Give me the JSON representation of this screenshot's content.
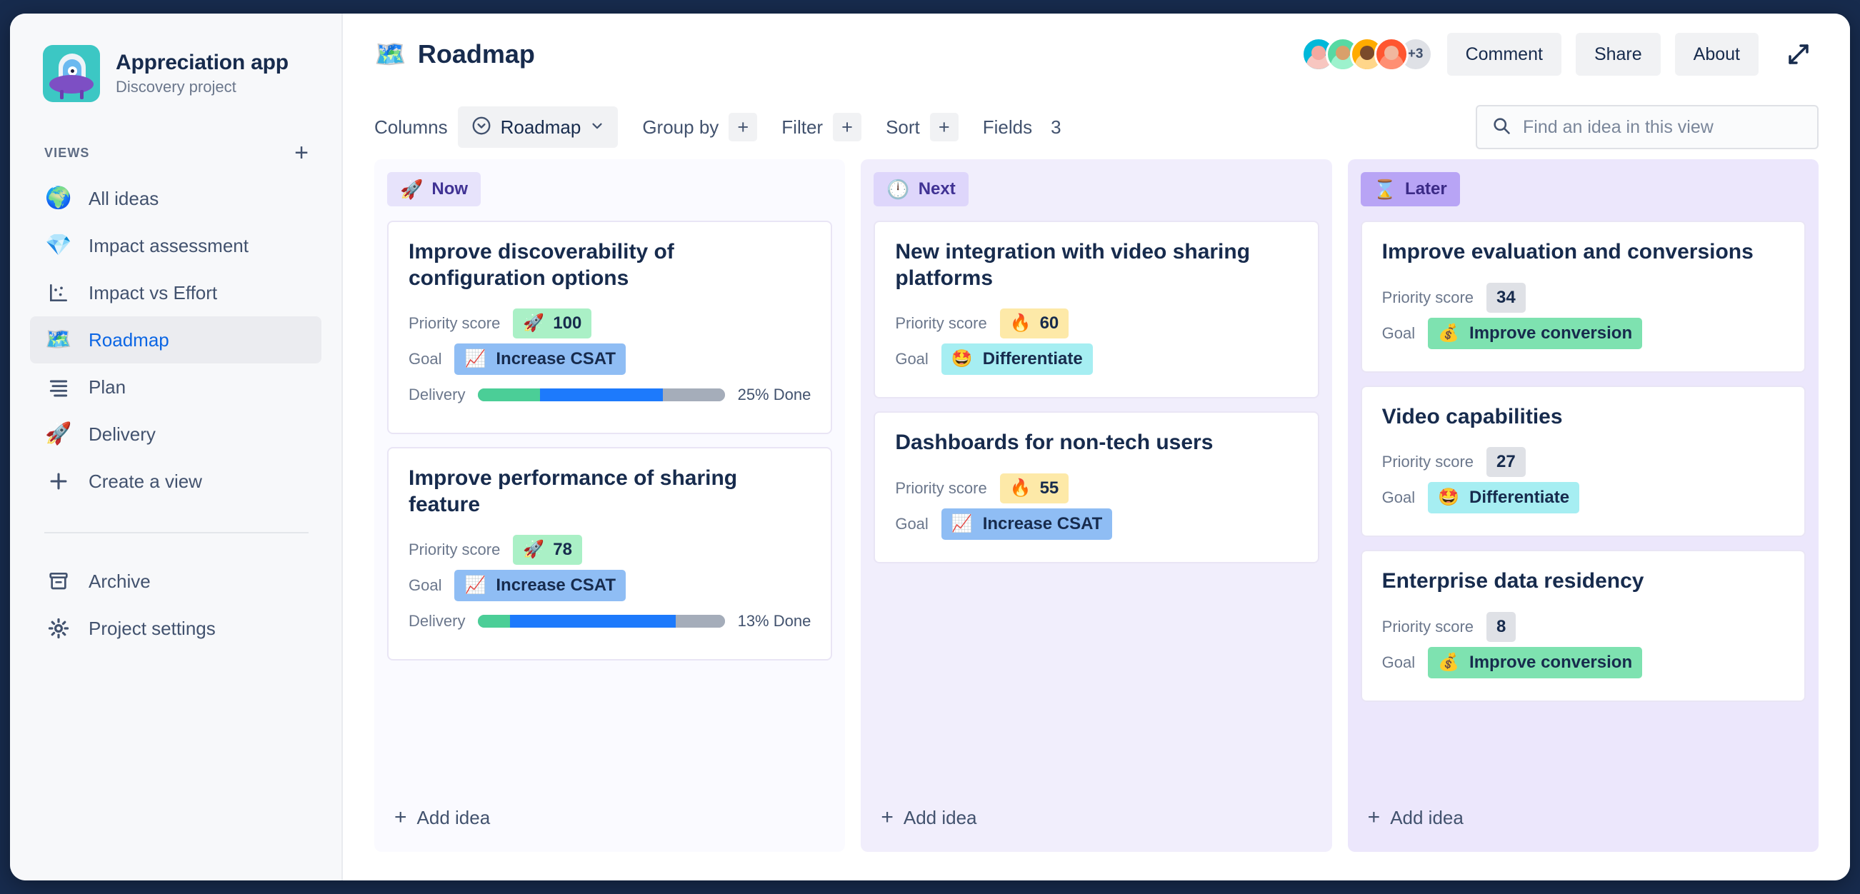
{
  "sidebar": {
    "project": {
      "name": "Appreciation app",
      "subtitle": "Discovery project",
      "logo_icon": "ufo-logo"
    },
    "views_label": "VIEWS",
    "add_view_icon": "plus-icon",
    "items": [
      {
        "label": "All ideas",
        "icon": "compass-icon",
        "emoji": "🧭",
        "active": false
      },
      {
        "label": "Impact assessment",
        "icon": "gem-icon",
        "emoji": "💎",
        "active": false
      },
      {
        "label": "Impact vs Effort",
        "icon": "scatter-chart-icon",
        "emoji": "",
        "active": false
      },
      {
        "label": "Roadmap",
        "icon": "map-icon",
        "emoji": "🗺️",
        "active": true
      },
      {
        "label": "Plan",
        "icon": "list-icon",
        "emoji": "",
        "active": false
      },
      {
        "label": "Delivery",
        "icon": "rocket-icon",
        "emoji": "🚀",
        "active": false
      },
      {
        "label": "Create a view",
        "icon": "plus-icon",
        "emoji": "",
        "active": false
      }
    ],
    "bottom_items": [
      {
        "label": "Archive",
        "icon": "archive-icon"
      },
      {
        "label": "Project settings",
        "icon": "gear-icon"
      }
    ]
  },
  "topbar": {
    "view_emoji": "🗺️",
    "view_title": "Roadmap",
    "avatar_overflow": "+3",
    "avatar_colors": [
      "#00b8d9",
      "#57d9a3",
      "#ffab00",
      "#ff5630"
    ],
    "buttons": [
      {
        "label": "Comment",
        "name": "comment-button"
      },
      {
        "label": "Share",
        "name": "share-button"
      },
      {
        "label": "About",
        "name": "about-button"
      }
    ],
    "expand_icon": "expand-arrows-icon"
  },
  "toolbar": {
    "columns_label": "Columns",
    "columns_value": "Roadmap",
    "columns_icon": "chevron-down-circle-icon",
    "group_by_label": "Group by",
    "filter_label": "Filter",
    "sort_label": "Sort",
    "fields_label": "Fields",
    "fields_count": "3",
    "add_icon": "plus-icon"
  },
  "search": {
    "placeholder": "Find an idea in this view",
    "value": "",
    "icon": "search-icon"
  },
  "board": {
    "add_idea_label": "Add idea",
    "priority_label": "Priority score",
    "goal_label": "Goal",
    "delivery_label": "Delivery",
    "columns": [
      {
        "id": "now",
        "badge": "Now",
        "badge_emoji": "🚀",
        "cards": [
          {
            "title": "Improve discoverability of configuration options",
            "priority": {
              "value": "100",
              "emoji": "🚀",
              "style": "green"
            },
            "goal": {
              "label": "Increase CSAT",
              "emoji": "📈",
              "style": "blue"
            },
            "delivery": {
              "text": "25% Done",
              "green_pct": 25,
              "blue_pct": 50,
              "grey_pct": 25
            }
          },
          {
            "title": "Improve performance of sharing feature",
            "priority": {
              "value": "78",
              "emoji": "🚀",
              "style": "green"
            },
            "goal": {
              "label": "Increase CSAT",
              "emoji": "📈",
              "style": "blue"
            },
            "delivery": {
              "text": "13% Done",
              "green_pct": 13,
              "blue_pct": 67,
              "grey_pct": 20
            }
          }
        ]
      },
      {
        "id": "next",
        "badge": "Next",
        "badge_emoji": "🕛",
        "cards": [
          {
            "title": "New integration with video sharing platforms",
            "priority": {
              "value": "60",
              "emoji": "🔥",
              "style": "yellow"
            },
            "goal": {
              "label": "Differentiate",
              "emoji": "🤩",
              "style": "cyan"
            },
            "delivery": null
          },
          {
            "title": "Dashboards for non-tech users",
            "priority": {
              "value": "55",
              "emoji": "🔥",
              "style": "yellow"
            },
            "goal": {
              "label": "Increase CSAT",
              "emoji": "📈",
              "style": "blue"
            },
            "delivery": null
          }
        ]
      },
      {
        "id": "later",
        "badge": "Later",
        "badge_emoji": "⏳",
        "cards": [
          {
            "title": "Improve evaluation and conversions",
            "priority": {
              "value": "34",
              "emoji": "",
              "style": "grey"
            },
            "goal": {
              "label": "Improve conversion",
              "emoji": "💰",
              "style": "green"
            },
            "delivery": null
          },
          {
            "title": "Video capabilities",
            "priority": {
              "value": "27",
              "emoji": "",
              "style": "grey"
            },
            "goal": {
              "label": "Differentiate",
              "emoji": "🤩",
              "style": "cyan"
            },
            "delivery": null
          },
          {
            "title": "Enterprise data residency",
            "priority": {
              "value": "8",
              "emoji": "",
              "style": "grey"
            },
            "goal": {
              "label": "Improve conversion",
              "emoji": "💰",
              "style": "green"
            },
            "delivery": null
          }
        ]
      }
    ]
  }
}
